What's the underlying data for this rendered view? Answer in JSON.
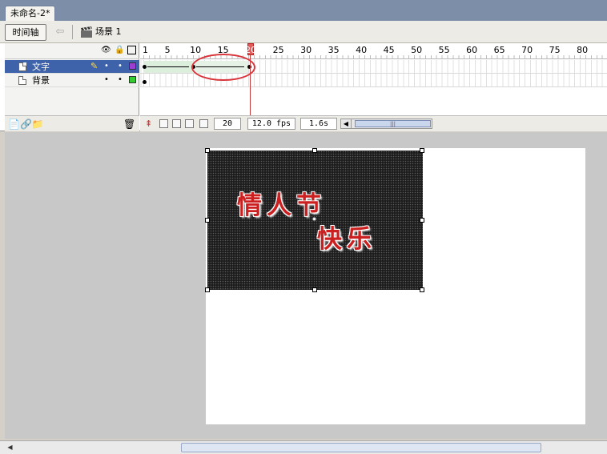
{
  "document": {
    "tab_title": "未命名-2*"
  },
  "toolbar": {
    "timeline_button": "时间轴",
    "scene_label": "场景 1"
  },
  "timeline": {
    "ruler_labels": [
      "1",
      "5",
      "10",
      "15",
      "20",
      "25",
      "30",
      "35",
      "40",
      "45",
      "50",
      "55",
      "60",
      "65",
      "70",
      "75",
      "80"
    ],
    "layers": [
      {
        "name": "文字",
        "selected": true,
        "color": "#9a3fd0"
      },
      {
        "name": "背景",
        "selected": false,
        "color": "#33cc33"
      }
    ],
    "current_frame": "20",
    "fps": "12.0 fps",
    "elapsed": "1.6s",
    "hscroll_glyph": "|||"
  },
  "stage": {
    "text_line1": "情人节",
    "text_line2": "快乐"
  }
}
